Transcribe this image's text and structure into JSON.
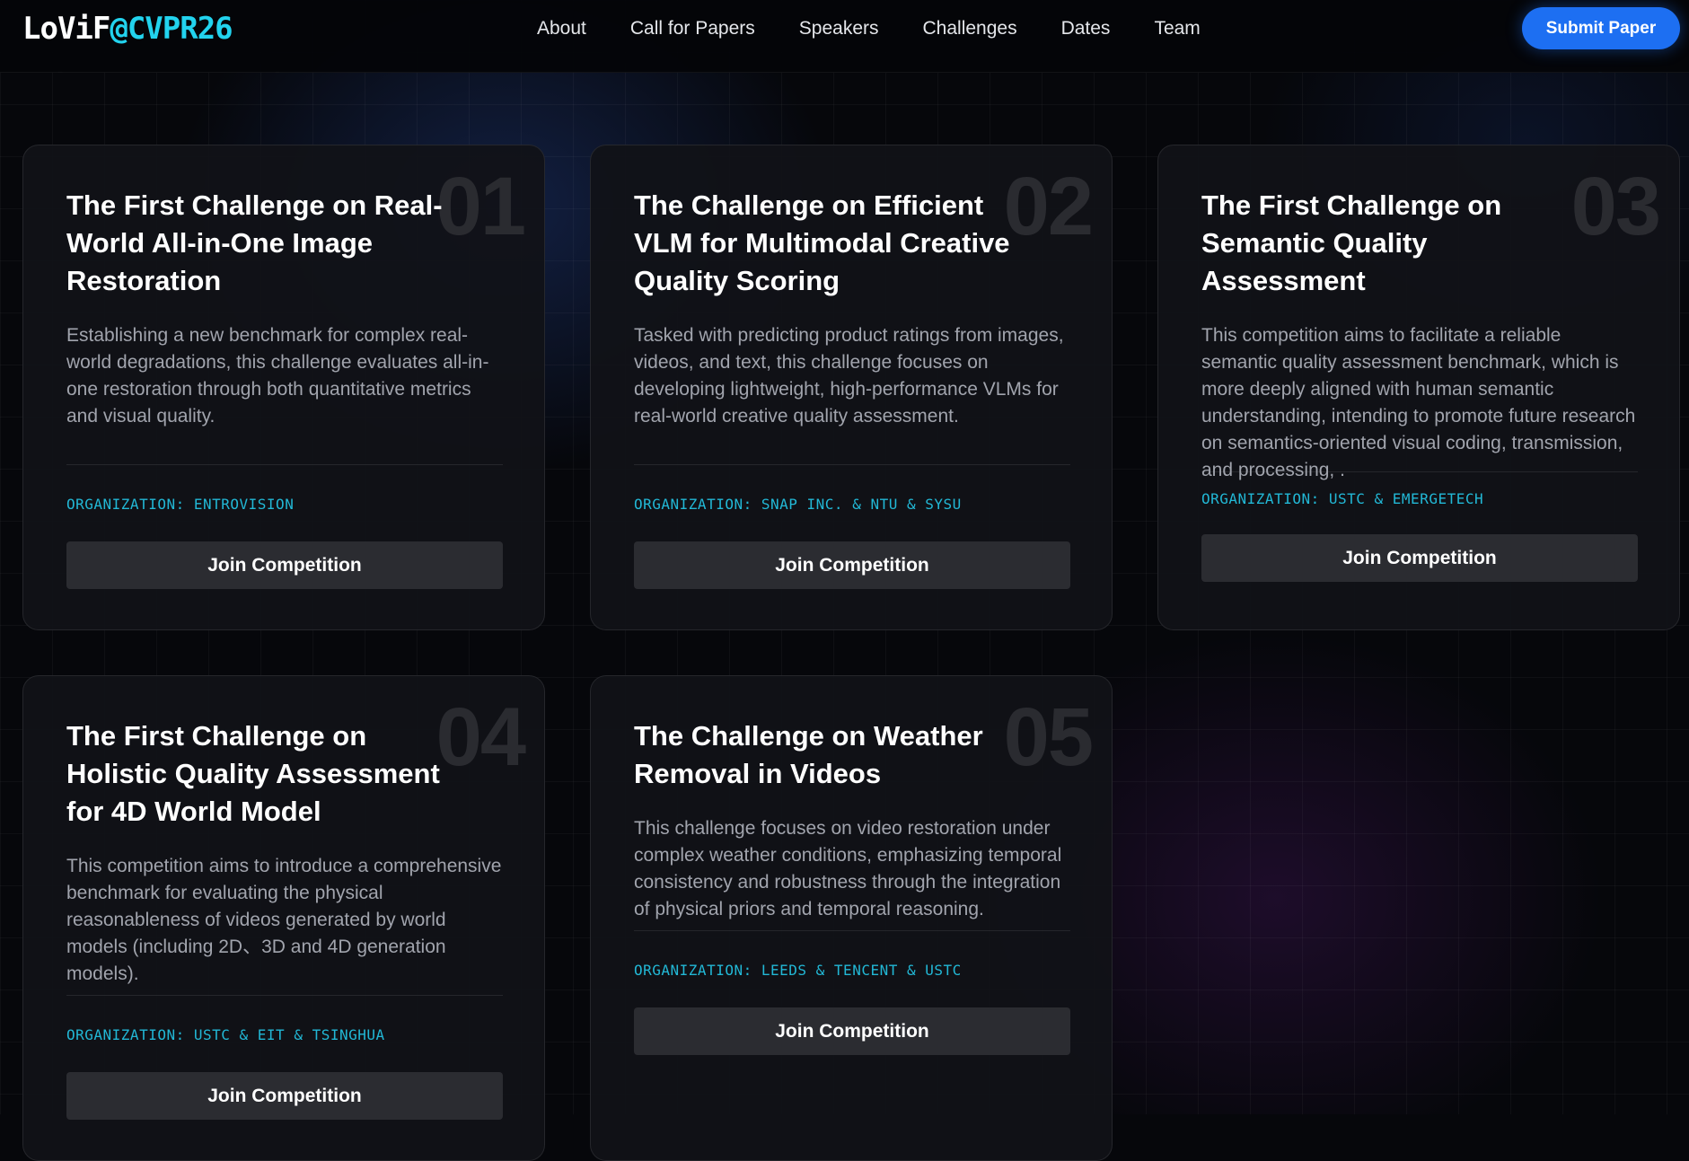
{
  "nav": {
    "logo_part1": "LoViF",
    "logo_part2": "@CVPR26",
    "links": [
      "About",
      "Call for Papers",
      "Speakers",
      "Challenges",
      "Dates",
      "Team"
    ],
    "submit_label": "Submit Paper"
  },
  "cards": [
    {
      "number": "01",
      "title": "The First Challenge on Real-World All-in-One Image Restoration",
      "description": "Establishing a new benchmark for complex real-world degradations, this challenge evaluates all-in-one restoration through both quantitative metrics and visual quality.",
      "organization": "ORGANIZATION: ENTROVISION",
      "button_label": "Join Competition"
    },
    {
      "number": "02",
      "title": "The Challenge on Efficient VLM for Multimodal Creative Quality Scoring",
      "description": "Tasked with predicting product ratings from images, videos, and text, this challenge focuses on developing lightweight, high-performance VLMs for real-world creative quality assessment.",
      "organization": "ORGANIZATION: SNAP INC. & NTU & SYSU",
      "button_label": "Join Competition"
    },
    {
      "number": "03",
      "title": "The First Challenge on Semantic Quality Assessment",
      "description": "This competition aims to facilitate a reliable semantic quality assessment benchmark, which is more deeply aligned with human semantic understanding, intending to promote future research on semantics-oriented visual coding, transmission, and processing, .",
      "organization": "ORGANIZATION: USTC & EMERGETECH",
      "button_label": "Join Competition"
    },
    {
      "number": "04",
      "title": "The First Challenge on Holistic Quality Assessment for 4D World Model",
      "description": "This competition aims to introduce a comprehensive benchmark for evaluating the physical reasonableness of videos generated by world models (including 2D、3D and 4D generation models).",
      "organization": "ORGANIZATION: USTC & EIT & TSINGHUA",
      "button_label": "Join Competition"
    },
    {
      "number": "05",
      "title": "The Challenge on Weather Removal in Videos",
      "description": "This challenge focuses on video restoration under complex weather conditions, emphasizing temporal consistency and robustness through the integration of physical priors and temporal reasoning.",
      "organization": "ORGANIZATION: LEEDS & TENCENT & USTC",
      "button_label": "Join Competition"
    }
  ],
  "colors": {
    "accent_cyan": "#22d3ee",
    "submit_blue": "#1d6ff2",
    "background": "#06070b",
    "card_bg": "#111217"
  }
}
